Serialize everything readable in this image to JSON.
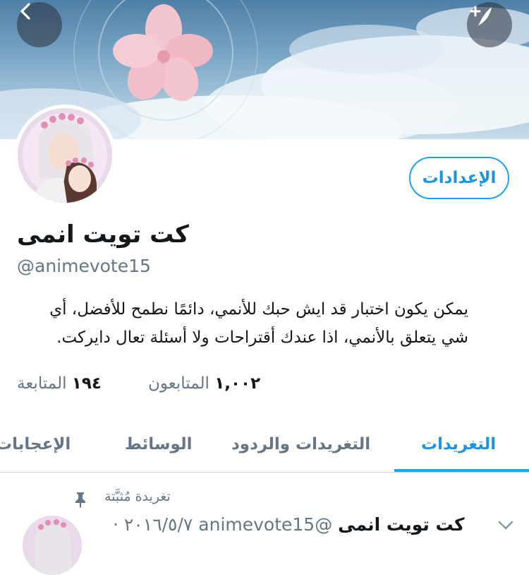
{
  "header": {
    "back_icon": "chevron-left-icon",
    "compose_icon": "compose-feather-icon"
  },
  "profile": {
    "settings_label": "الإعدادات",
    "display_name": "كت تويت انمى",
    "handle": "@animevote15",
    "bio_line1": "يمكن يكون اختبار قد ايش حبك للأنمي، دائمًا نطمح للأفضل، أي",
    "bio_line2": "شي يتعلق بالأنمي، اذا عندك أقتراحات ولا أسئلة تعال دايركت.",
    "following_count": "١٩٤",
    "following_label": "المتابعة",
    "followers_count": "١,٠٠٢",
    "followers_label": "المتابعون"
  },
  "tabs": [
    {
      "label": "التغريدات",
      "active": true
    },
    {
      "label": "التغريدات والردود",
      "active": false
    },
    {
      "label": "الوسائط",
      "active": false
    },
    {
      "label": "الإعجابات",
      "active": false
    }
  ],
  "pinned_tweet": {
    "pinned_label": "تغريدة مُثبَّتة",
    "author_name": "كت تويت انمى",
    "author_handle": "@animevote15",
    "date": "٢٠١٦/٥/٧ ·"
  },
  "colors": {
    "accent": "#1da1f2",
    "secondary_text": "#657786"
  }
}
